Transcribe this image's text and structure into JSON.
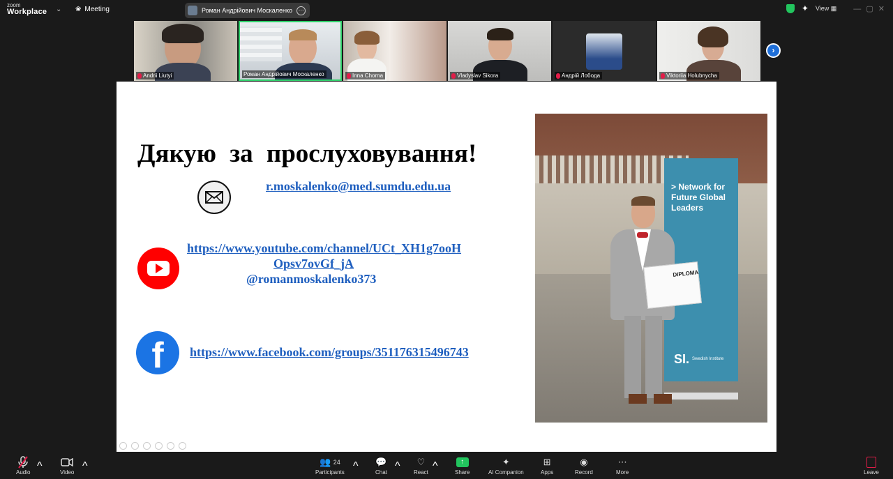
{
  "app": {
    "logo_line1": "zoom",
    "logo_line2": "Workplace",
    "meeting_label": "Meeting"
  },
  "active_speaker": {
    "name": "Роман Андрійович Москаленко"
  },
  "top_right": {
    "view_label": "View"
  },
  "participants_strip": [
    {
      "name": "Andrii Liutyi",
      "muted": true,
      "active": false
    },
    {
      "name": "Роман Андрійович Москаленко",
      "muted": false,
      "active": true
    },
    {
      "name": "Inna Chorna",
      "muted": true,
      "active": false
    },
    {
      "name": "Vladyslav Sikora",
      "muted": true,
      "active": false
    },
    {
      "name": "Андрій Лобода",
      "muted": true,
      "active": false
    },
    {
      "name": "Viktoriia Holubnycha",
      "muted": true,
      "active": false
    }
  ],
  "slide": {
    "title": "Дякую  за  прослуховування!",
    "email": "r.moskalenko@med.sumdu.edu.ua",
    "youtube_line1": "https://www.youtube.com/channel/UCt_XH1g7ooH",
    "youtube_line2": "Opsv7ovGf_jA",
    "youtube_handle": "@romanmoskalenko373",
    "facebook": "https://www.facebook.com/groups/351176315496743",
    "photo": {
      "banner_text": "> Network for Future Global Leaders",
      "si_logo": "SI.",
      "si_text": "Swedish Institute",
      "diploma_text": "DIPLOMA"
    }
  },
  "toolbar": {
    "audio": "Audio",
    "video": "Video",
    "participants": "Participants",
    "participants_count": "24",
    "chat": "Chat",
    "react": "React",
    "share": "Share",
    "ai_companion": "AI Companion",
    "apps": "Apps",
    "record": "Record",
    "more": "More",
    "leave": "Leave"
  }
}
